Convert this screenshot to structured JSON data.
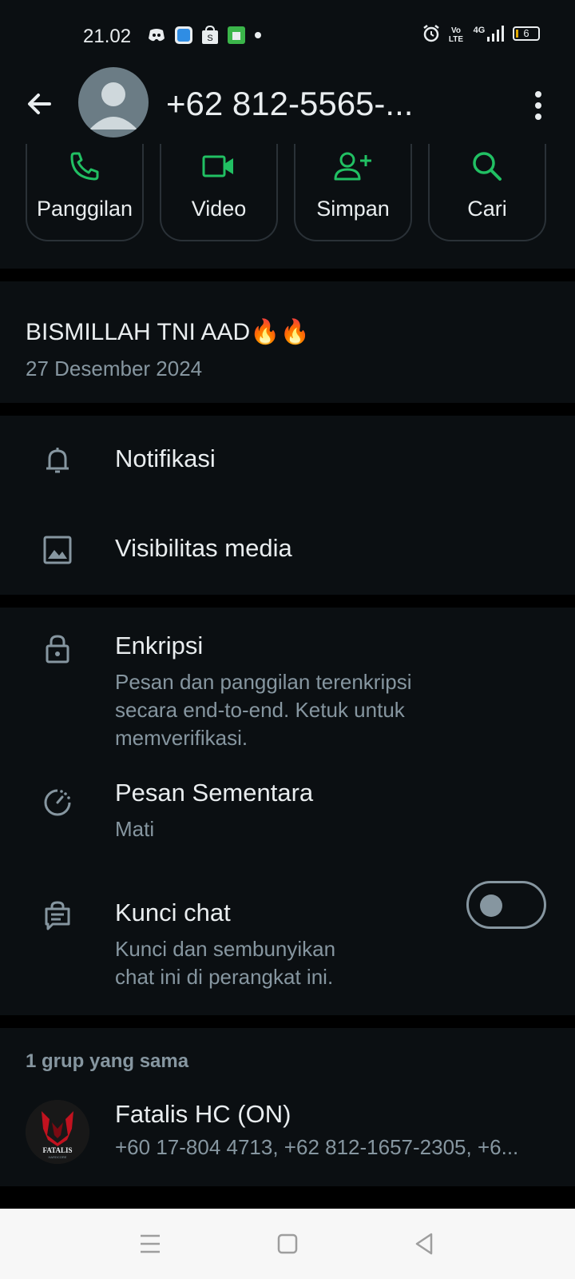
{
  "status_bar": {
    "time": "21.02",
    "battery_level": "6",
    "icons_left": [
      "discord-icon",
      "app-icon",
      "shopee-icon",
      "store-icon",
      "dot-icon"
    ],
    "icons_right": [
      "alarm-icon",
      "volte-icon",
      "4g-signal-icon",
      "battery-icon"
    ]
  },
  "header": {
    "title": "+62 812-5565-..."
  },
  "actions": [
    {
      "label": "Panggilan",
      "icon": "phone-icon"
    },
    {
      "label": "Video",
      "icon": "video-icon"
    },
    {
      "label": "Simpan",
      "icon": "add-contact-icon"
    },
    {
      "label": "Cari",
      "icon": "search-icon"
    }
  ],
  "about": {
    "status": "BISMILLAH TNI AAD🔥🔥",
    "date": "27 Desember 2024"
  },
  "settings": {
    "notifications": {
      "title": "Notifikasi"
    },
    "media_visibility": {
      "title": "Visibilitas media"
    },
    "encryption": {
      "title": "Enkripsi",
      "sub_line1": "Pesan dan panggilan terenkripsi",
      "sub_line2": "secara end-to-end. Ketuk untuk",
      "sub_line3": "memverifikasi."
    },
    "disappearing": {
      "title": "Pesan Sementara",
      "sub": "Mati"
    },
    "chat_lock": {
      "title": "Kunci chat",
      "sub_line1": "Kunci dan sembunyikan",
      "sub_line2": "chat ini di perangkat ini.",
      "enabled": false
    }
  },
  "groups": {
    "header": "1 grup yang sama",
    "items": [
      {
        "name": "Fatalis HC (ON)",
        "avatar_text": "FATALIS",
        "avatar_subtext": "HARDCORE",
        "members": "+60 17-804 4713, +62 812-1657-2305, +6..."
      }
    ]
  },
  "colors": {
    "accent": "#21c063",
    "background": "#0b0f12",
    "divider": "#000000",
    "text_primary": "#e9edef",
    "text_secondary": "#8696a0"
  }
}
